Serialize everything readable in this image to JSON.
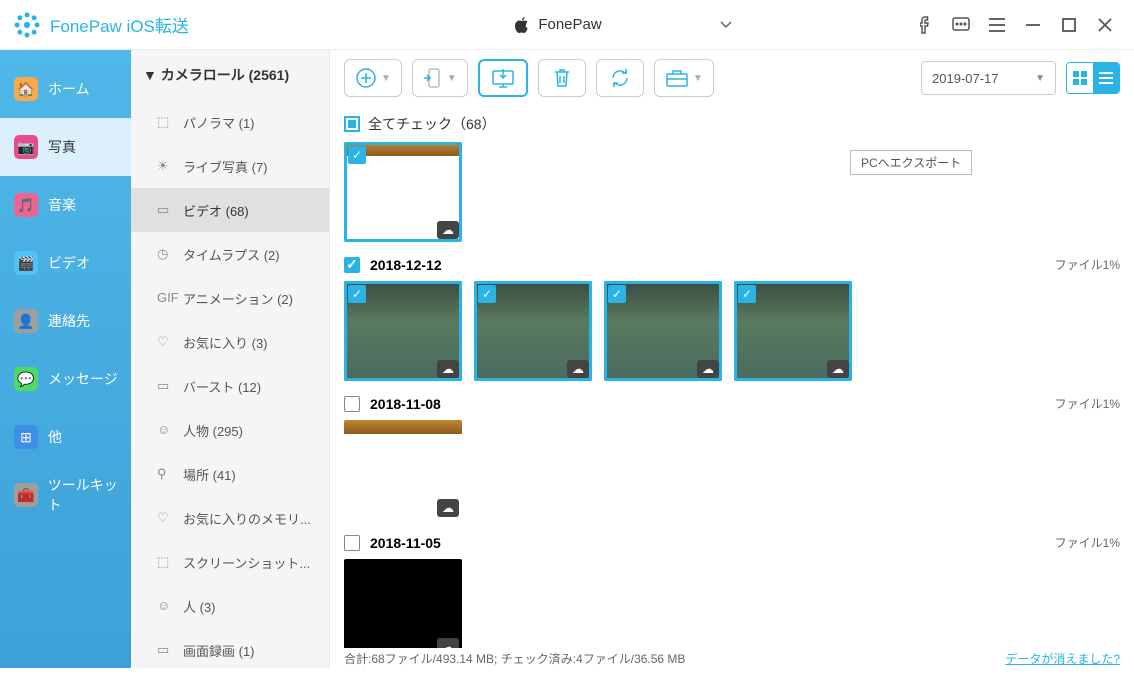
{
  "app_title": "FonePaw iOS転送",
  "device_name": "FonePaw",
  "nav": [
    {
      "label": "ホーム",
      "color": "#f7a94b"
    },
    {
      "label": "写真",
      "color": "#e74c8c"
    },
    {
      "label": "音楽",
      "color": "#f06292"
    },
    {
      "label": "ビデオ",
      "color": "#4fc3f7"
    },
    {
      "label": "連絡先",
      "color": "#9e9e9e"
    },
    {
      "label": "メッセージ",
      "color": "#4cd964"
    },
    {
      "label": "他",
      "color": "#3f8fe8"
    },
    {
      "label": "ツールキット",
      "color": "#9e9e9e"
    }
  ],
  "subnav_title": "▼ カメラロール (2561)",
  "subnav": [
    {
      "label": "パノラマ (1)"
    },
    {
      "label": "ライブ写真 (7)"
    },
    {
      "label": "ビデオ (68)"
    },
    {
      "label": "タイムラプス (2)"
    },
    {
      "label": "アニメーション (2)"
    },
    {
      "label": "お気に入り (3)"
    },
    {
      "label": "バースト (12)"
    },
    {
      "label": "人物 (295)"
    },
    {
      "label": "場所 (41)"
    },
    {
      "label": "お気に入りのメモリ..."
    },
    {
      "label": "スクリーンショット..."
    },
    {
      "label": "人 (3)"
    },
    {
      "label": "画面録画 (1)"
    }
  ],
  "tooltip": "PCへエクスポート",
  "select_all": "全てチェック（68）",
  "date_filter": "2019-07-17",
  "groups": [
    {
      "date": "2018-12-12",
      "right": "ファイル1%",
      "checked": true,
      "thumbs": 4,
      "style": "plant"
    },
    {
      "date": "2018-11-08",
      "right": "ファイル1%",
      "checked": false,
      "thumbs": 1,
      "style": "screenshot"
    },
    {
      "date": "2018-11-05",
      "right": "ファイル1%",
      "checked": false,
      "thumbs": 1,
      "style": "black"
    }
  ],
  "first_group_thumb_style": "screenshot",
  "status": "合計:68ファイル/493.14 MB; チェック済み:4ファイル/36.56 MB",
  "status_link": "データが消えました?"
}
